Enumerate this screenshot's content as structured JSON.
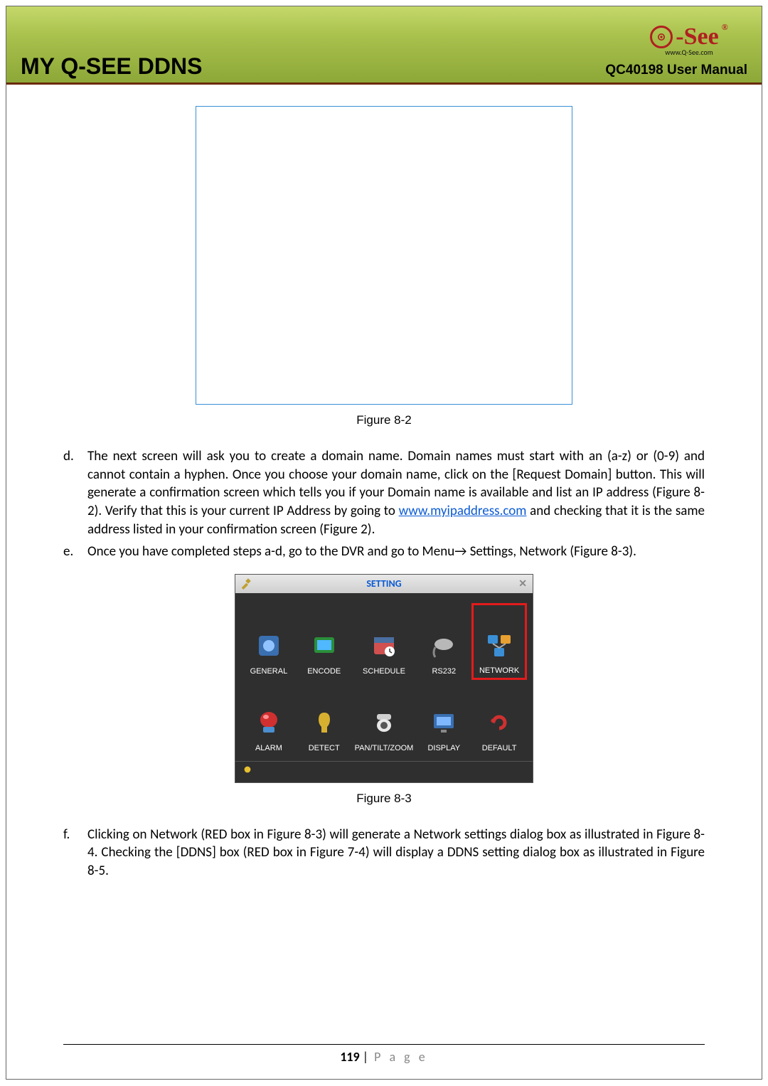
{
  "header": {
    "title": "MY Q-SEE DDNS",
    "subtitle": "QC40198 User Manual",
    "logo_text": "-See",
    "logo_sub": "www.Q-See.com",
    "logo_trademark": "®"
  },
  "figure1": {
    "caption": "Figure 8-2"
  },
  "para_d": {
    "marker": "d.",
    "text_before_link": "The next screen will ask you to create a domain name.  Domain names must start with an (a-z) or (0-9) and cannot contain a hyphen.  Once you choose your domain name, click on the [Request Domain] button.  This will generate a confirmation screen which tells you if your Domain name is available and list an IP address (Figure 8-2).  Verify that this is your current IP Address by going to ",
    "link": "www.myipaddress.com",
    "text_after_link": " and checking that it is the same address listed in your confirmation screen (Figure 2)."
  },
  "para_e": {
    "marker": "e.",
    "text": "Once you have completed steps a-d, go to the DVR and go to Menu→ Settings, Network (Figure 8-3)."
  },
  "settings": {
    "title": "SETTING",
    "items_row1": [
      {
        "label": "GENERAL"
      },
      {
        "label": "ENCODE"
      },
      {
        "label": "SCHEDULE"
      },
      {
        "label": "RS232"
      },
      {
        "label": "NETWORK"
      }
    ],
    "items_row2": [
      {
        "label": "ALARM"
      },
      {
        "label": "DETECT"
      },
      {
        "label": "PAN/TILT/ZOOM"
      },
      {
        "label": "DISPLAY"
      },
      {
        "label": "DEFAULT"
      }
    ]
  },
  "figure2": {
    "caption": "Figure 8-3"
  },
  "para_f": {
    "marker": "f.",
    "text": "Clicking on Network (RED box in Figure 8-3) will generate a Network settings dialog box as illustrated in Figure 8-4. Checking the [DDNS] box (RED box in Figure 7-4) will display a DDNS setting dialog box as illustrated in Figure 8-5."
  },
  "footer": {
    "page_number": "119",
    "separator": " | ",
    "label": "P a g e"
  }
}
